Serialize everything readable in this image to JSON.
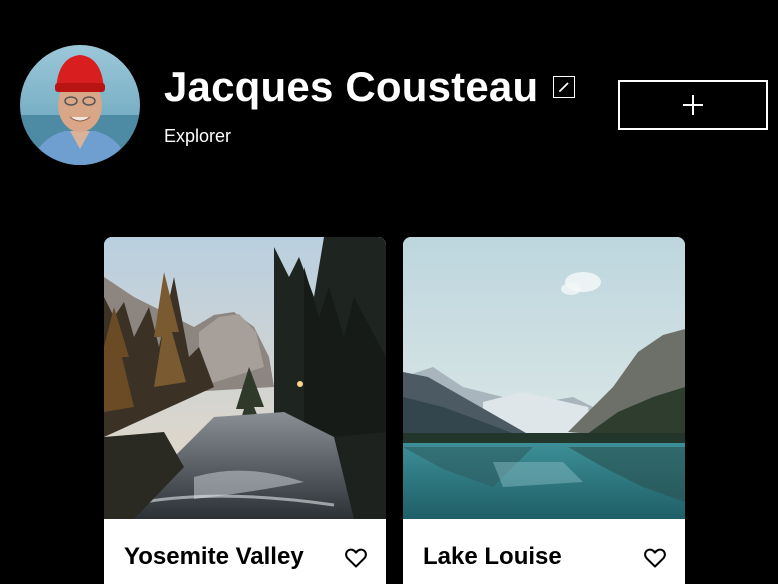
{
  "profile": {
    "name": "Jacques Cousteau",
    "role": "Explorer",
    "avatar_icon": "portrait-photo",
    "edit_icon": "pencil-icon",
    "add_icon": "plus-icon"
  },
  "cards": [
    {
      "title": "Yosemite Valley",
      "image": "forest-river-photo",
      "like_icon": "heart-outline-icon"
    },
    {
      "title": "Lake Louise",
      "image": "mountain-lake-photo",
      "like_icon": "heart-outline-icon"
    }
  ],
  "colors": {
    "background": "#000000",
    "foreground": "#ffffff",
    "card_background": "#ffffff",
    "card_text": "#000000"
  }
}
